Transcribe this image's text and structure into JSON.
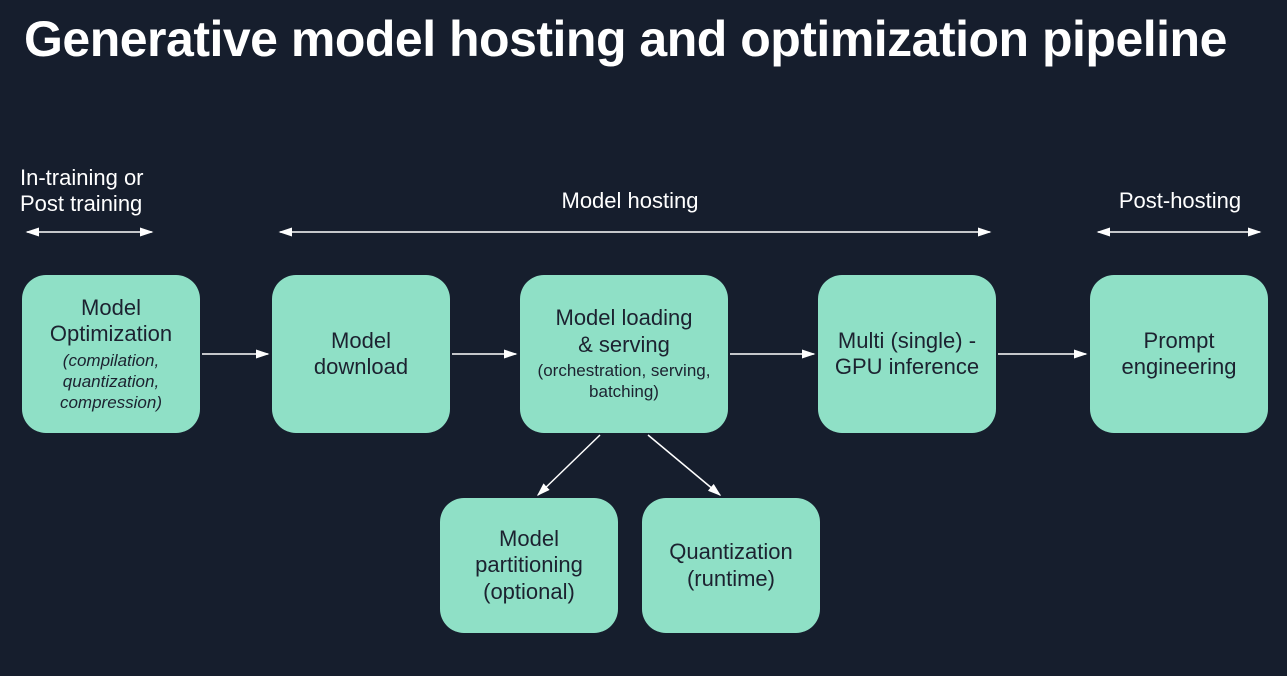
{
  "title": "Generative model hosting and optimization pipeline",
  "phases": {
    "pre": "In-training or\nPost training",
    "hosting": "Model hosting",
    "post": "Post-hosting"
  },
  "boxes": {
    "optimize": {
      "main": "Model\nOptimization",
      "sub": "(compilation,\nquantization,\ncompression)"
    },
    "download": {
      "main": "Model\ndownload"
    },
    "loading": {
      "main": "Model loading\n& serving",
      "subp": "(orchestration, serving,\nbatching)"
    },
    "gpu": {
      "main": "Multi (single) -\nGPU inference"
    },
    "prompt": {
      "main": "Prompt\nengineering"
    },
    "partition": {
      "main": "Model\npartitioning\n(optional)"
    },
    "quant": {
      "main": "Quantization\n(runtime)"
    }
  }
}
